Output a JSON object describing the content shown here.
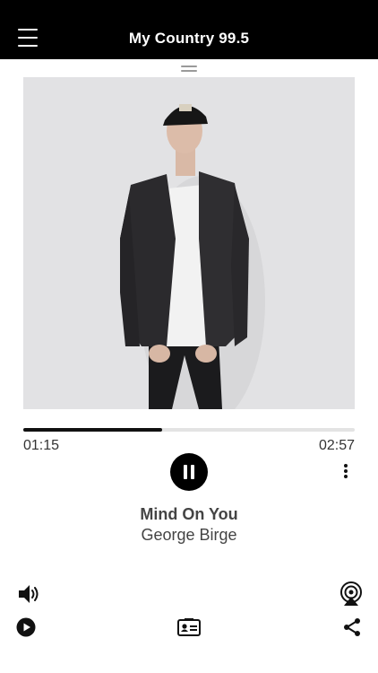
{
  "header": {
    "title": "My Country 99.5",
    "menu_icon": "hamburger-menu-icon"
  },
  "player": {
    "artwork_description_icon": "album-artwork",
    "progress_fraction": 0.42,
    "time_elapsed": "01:15",
    "time_total": "02:57",
    "state": "playing",
    "song_title": "Mind On You",
    "artist": "George Birge"
  },
  "toolbar": {
    "left_top_icon": "volume-icon",
    "right_top_icon": "airplay-broadcast-icon",
    "left_bottom_icon": "play-circle-icon",
    "center_bottom_icon": "contact-card-icon",
    "right_bottom_icon": "share-icon"
  },
  "colors": {
    "header_bg": "#000000",
    "accent": "#111111",
    "track": "#e3e3e3"
  }
}
